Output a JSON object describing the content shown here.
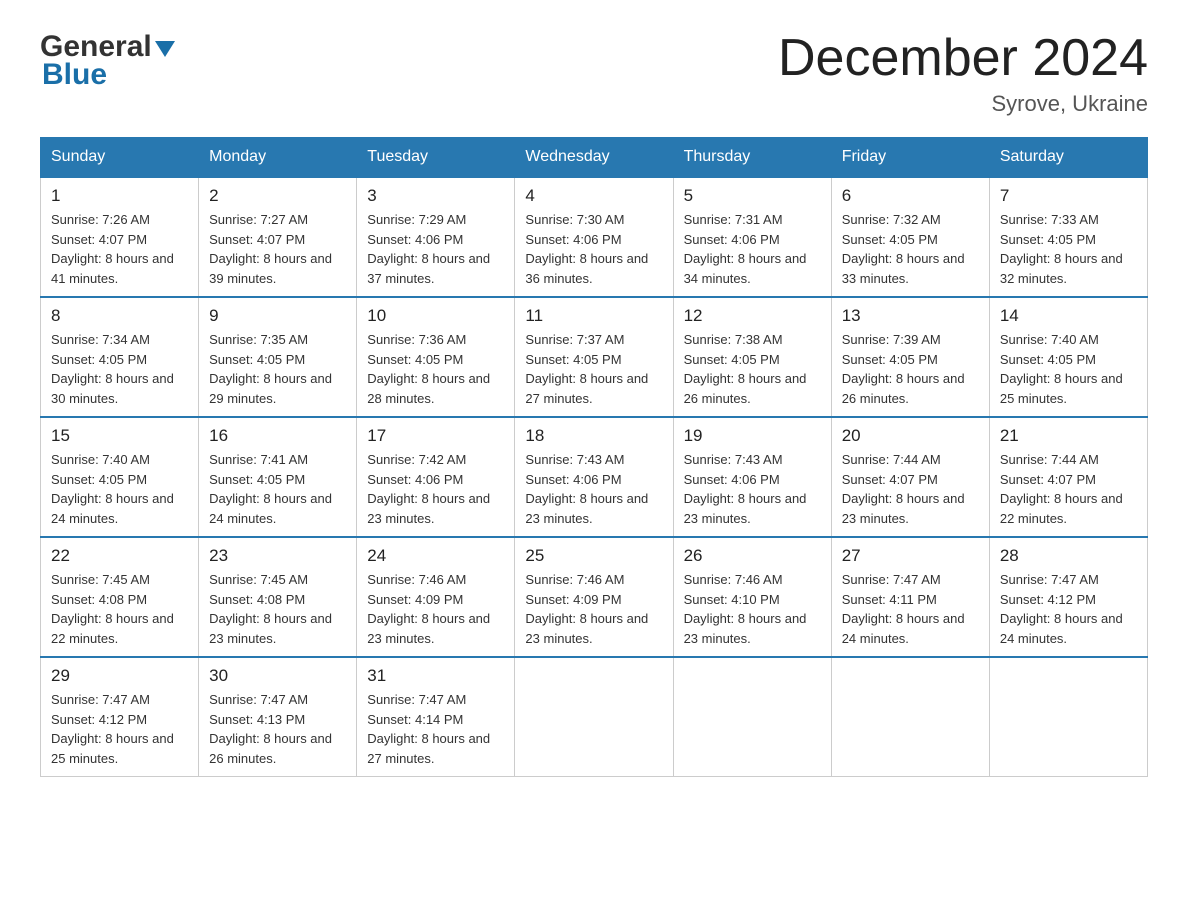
{
  "header": {
    "logo_general": "General",
    "logo_blue": "Blue",
    "month_title": "December 2024",
    "location": "Syrove, Ukraine"
  },
  "days_of_week": [
    "Sunday",
    "Monday",
    "Tuesday",
    "Wednesday",
    "Thursday",
    "Friday",
    "Saturday"
  ],
  "weeks": [
    [
      {
        "day": "1",
        "sunrise": "7:26 AM",
        "sunset": "4:07 PM",
        "daylight": "8 hours and 41 minutes."
      },
      {
        "day": "2",
        "sunrise": "7:27 AM",
        "sunset": "4:07 PM",
        "daylight": "8 hours and 39 minutes."
      },
      {
        "day": "3",
        "sunrise": "7:29 AM",
        "sunset": "4:06 PM",
        "daylight": "8 hours and 37 minutes."
      },
      {
        "day": "4",
        "sunrise": "7:30 AM",
        "sunset": "4:06 PM",
        "daylight": "8 hours and 36 minutes."
      },
      {
        "day": "5",
        "sunrise": "7:31 AM",
        "sunset": "4:06 PM",
        "daylight": "8 hours and 34 minutes."
      },
      {
        "day": "6",
        "sunrise": "7:32 AM",
        "sunset": "4:05 PM",
        "daylight": "8 hours and 33 minutes."
      },
      {
        "day": "7",
        "sunrise": "7:33 AM",
        "sunset": "4:05 PM",
        "daylight": "8 hours and 32 minutes."
      }
    ],
    [
      {
        "day": "8",
        "sunrise": "7:34 AM",
        "sunset": "4:05 PM",
        "daylight": "8 hours and 30 minutes."
      },
      {
        "day": "9",
        "sunrise": "7:35 AM",
        "sunset": "4:05 PM",
        "daylight": "8 hours and 29 minutes."
      },
      {
        "day": "10",
        "sunrise": "7:36 AM",
        "sunset": "4:05 PM",
        "daylight": "8 hours and 28 minutes."
      },
      {
        "day": "11",
        "sunrise": "7:37 AM",
        "sunset": "4:05 PM",
        "daylight": "8 hours and 27 minutes."
      },
      {
        "day": "12",
        "sunrise": "7:38 AM",
        "sunset": "4:05 PM",
        "daylight": "8 hours and 26 minutes."
      },
      {
        "day": "13",
        "sunrise": "7:39 AM",
        "sunset": "4:05 PM",
        "daylight": "8 hours and 26 minutes."
      },
      {
        "day": "14",
        "sunrise": "7:40 AM",
        "sunset": "4:05 PM",
        "daylight": "8 hours and 25 minutes."
      }
    ],
    [
      {
        "day": "15",
        "sunrise": "7:40 AM",
        "sunset": "4:05 PM",
        "daylight": "8 hours and 24 minutes."
      },
      {
        "day": "16",
        "sunrise": "7:41 AM",
        "sunset": "4:05 PM",
        "daylight": "8 hours and 24 minutes."
      },
      {
        "day": "17",
        "sunrise": "7:42 AM",
        "sunset": "4:06 PM",
        "daylight": "8 hours and 23 minutes."
      },
      {
        "day": "18",
        "sunrise": "7:43 AM",
        "sunset": "4:06 PM",
        "daylight": "8 hours and 23 minutes."
      },
      {
        "day": "19",
        "sunrise": "7:43 AM",
        "sunset": "4:06 PM",
        "daylight": "8 hours and 23 minutes."
      },
      {
        "day": "20",
        "sunrise": "7:44 AM",
        "sunset": "4:07 PM",
        "daylight": "8 hours and 23 minutes."
      },
      {
        "day": "21",
        "sunrise": "7:44 AM",
        "sunset": "4:07 PM",
        "daylight": "8 hours and 22 minutes."
      }
    ],
    [
      {
        "day": "22",
        "sunrise": "7:45 AM",
        "sunset": "4:08 PM",
        "daylight": "8 hours and 22 minutes."
      },
      {
        "day": "23",
        "sunrise": "7:45 AM",
        "sunset": "4:08 PM",
        "daylight": "8 hours and 23 minutes."
      },
      {
        "day": "24",
        "sunrise": "7:46 AM",
        "sunset": "4:09 PM",
        "daylight": "8 hours and 23 minutes."
      },
      {
        "day": "25",
        "sunrise": "7:46 AM",
        "sunset": "4:09 PM",
        "daylight": "8 hours and 23 minutes."
      },
      {
        "day": "26",
        "sunrise": "7:46 AM",
        "sunset": "4:10 PM",
        "daylight": "8 hours and 23 minutes."
      },
      {
        "day": "27",
        "sunrise": "7:47 AM",
        "sunset": "4:11 PM",
        "daylight": "8 hours and 24 minutes."
      },
      {
        "day": "28",
        "sunrise": "7:47 AM",
        "sunset": "4:12 PM",
        "daylight": "8 hours and 24 minutes."
      }
    ],
    [
      {
        "day": "29",
        "sunrise": "7:47 AM",
        "sunset": "4:12 PM",
        "daylight": "8 hours and 25 minutes."
      },
      {
        "day": "30",
        "sunrise": "7:47 AM",
        "sunset": "4:13 PM",
        "daylight": "8 hours and 26 minutes."
      },
      {
        "day": "31",
        "sunrise": "7:47 AM",
        "sunset": "4:14 PM",
        "daylight": "8 hours and 27 minutes."
      },
      null,
      null,
      null,
      null
    ]
  ]
}
